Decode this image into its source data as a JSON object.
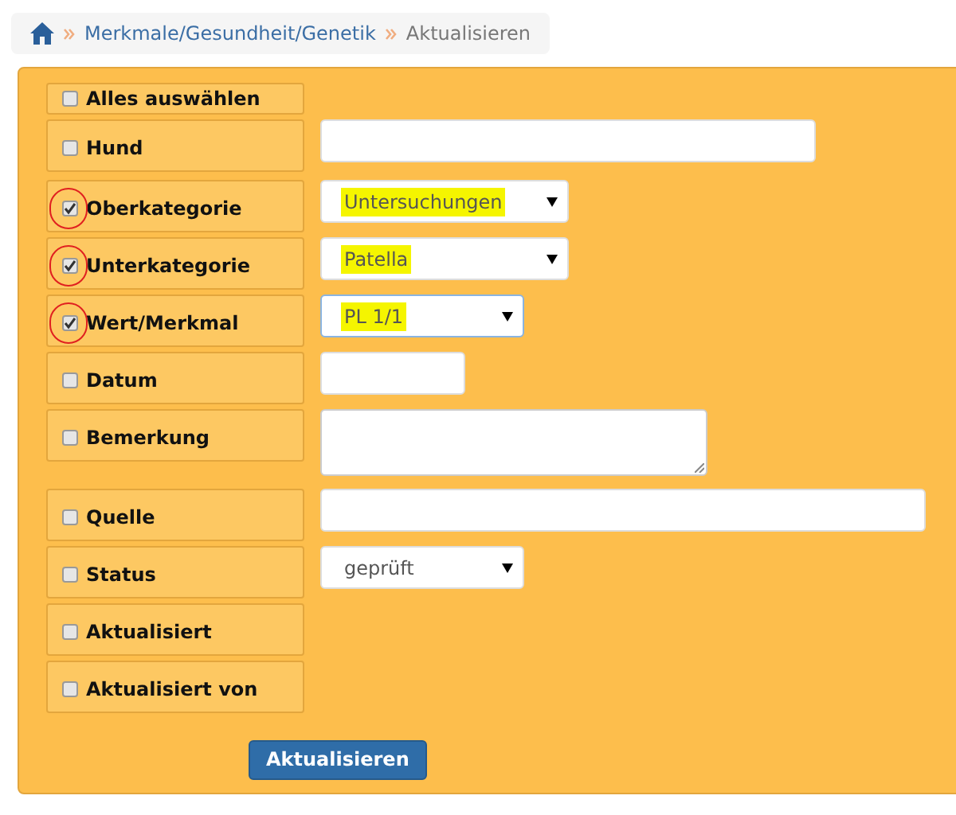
{
  "breadcrumb": [
    {
      "kind": "home"
    },
    {
      "kind": "link",
      "label": "Merkmale/Gesundheit/Genetik"
    },
    {
      "kind": "current",
      "label": "Aktualisieren"
    }
  ],
  "select_all": {
    "label": "Alles auswählen",
    "checked": false
  },
  "rows": [
    {
      "kind": "text",
      "label": "Hund",
      "checked": false,
      "circled": false
    },
    {
      "kind": "select",
      "label": "Oberkategorie",
      "checked": true,
      "circled": true,
      "value": "Untersuchungen",
      "highlighted": true,
      "focused": false
    },
    {
      "kind": "select",
      "label": "Unterkategorie",
      "checked": true,
      "circled": true,
      "value": "Patella",
      "highlighted": true,
      "focused": false
    },
    {
      "kind": "select",
      "label": "Wert/Merkmal",
      "checked": true,
      "circled": true,
      "value": "PL 1/1",
      "highlighted": true,
      "focused": true
    },
    {
      "kind": "text",
      "label": "Datum",
      "checked": false,
      "circled": false
    },
    {
      "kind": "textarea",
      "label": "Bemerkung",
      "checked": false,
      "circled": false
    },
    {
      "kind": "text",
      "label": "Quelle",
      "checked": false,
      "circled": false
    },
    {
      "kind": "select",
      "label": "Status",
      "checked": false,
      "circled": false,
      "value": "geprüft",
      "highlighted": false,
      "focused": false
    },
    {
      "kind": "none",
      "label": "Aktualisiert",
      "checked": false,
      "circled": false
    },
    {
      "kind": "none",
      "label": "Aktualisiert von",
      "checked": false,
      "circled": false
    }
  ],
  "submit": {
    "label": "Aktualisieren"
  }
}
